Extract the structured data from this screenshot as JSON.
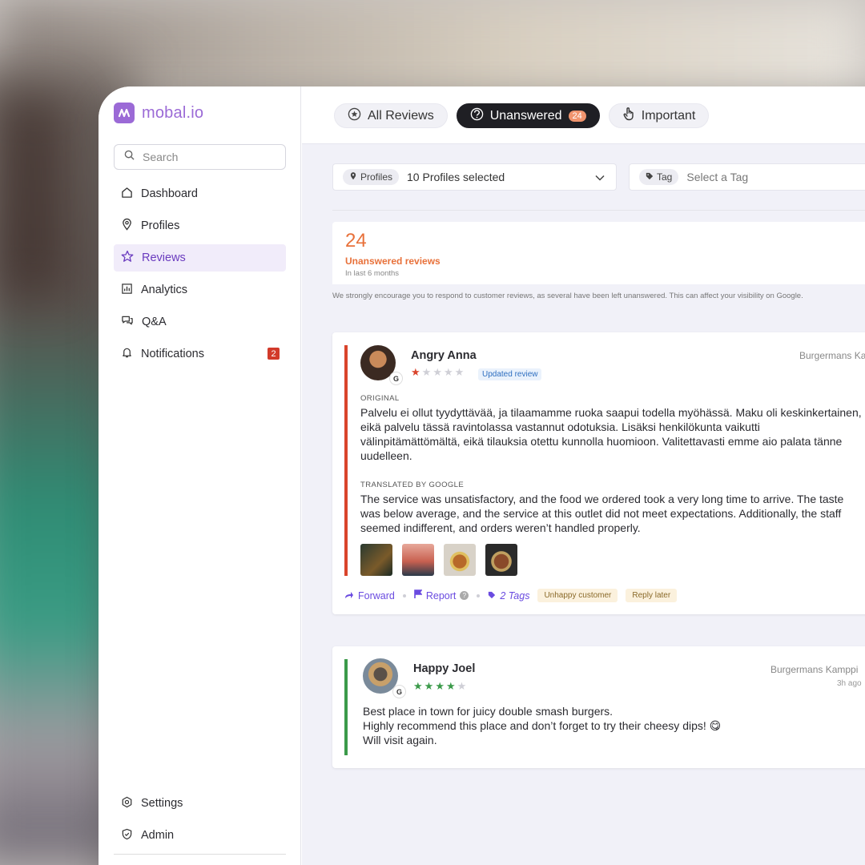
{
  "brand": {
    "name": "mobal.io",
    "color": "#9b6ad6"
  },
  "search": {
    "placeholder": "Search"
  },
  "sidebar": {
    "items": [
      {
        "label": "Dashboard",
        "icon": "home-icon"
      },
      {
        "label": "Profiles",
        "icon": "pin-icon"
      },
      {
        "label": "Reviews",
        "icon": "star-icon",
        "active": true
      },
      {
        "label": "Analytics",
        "icon": "chart-icon"
      },
      {
        "label": "Q&A",
        "icon": "chat-icon"
      },
      {
        "label": "Notifications",
        "icon": "bell-icon",
        "badge": "2"
      }
    ],
    "bottom": [
      {
        "label": "Settings",
        "icon": "gear-icon"
      },
      {
        "label": "Admin",
        "icon": "shield-icon"
      }
    ]
  },
  "tabs": [
    {
      "label": "All Reviews",
      "icon": "star-circle-icon"
    },
    {
      "label": "Unanswered",
      "icon": "chat-bubble-icon",
      "count": "24",
      "active": true
    },
    {
      "label": "Important",
      "icon": "hand-icon"
    }
  ],
  "filters": {
    "profiles": {
      "chip": "Profiles",
      "value": "10 Profiles selected"
    },
    "tag": {
      "chip": "Tag",
      "placeholder": "Select a Tag"
    }
  },
  "stats": {
    "count": "24",
    "label": "Unanswered reviews",
    "sub": "In last 6 months",
    "note": "We strongly encourage you to respond to customer reviews, as several have been left unanswered. This can affect your visibility on Google."
  },
  "reviews": [
    {
      "name": "Angry Anna",
      "rating": 1,
      "badge": "Updated review",
      "location": "Burgermans Kampi",
      "original_label": "ORIGINAL",
      "original": "Palvelu ei ollut tyydyttävää, ja tilaamamme ruoka saapui todella myöhässä. Maku oli keskinkertainen,\neikä palvelu tässä ravintolassa vastannut odotuksia. Lisäksi henkilökunta vaikutti\nvälinpitämättömältä, eikä tilauksia otettu kunnolla huomioon. Valitettavasti emme aio palata tänne\nuudelleen.",
      "translated_label": "TRANSLATED BY GOOGLE",
      "translated": "The service was unsatisfactory, and the food we ordered took a very long time to arrive. The taste\nwas below average, and the service at this outlet did not meet expectations. Additionally, the staff\nseemed indifferent, and orders weren’t handled properly.",
      "actions": {
        "forward": "Forward",
        "report": "Report",
        "tags": "2 Tags"
      },
      "tags": [
        "Unhappy customer",
        "Reply later"
      ],
      "accent": "#d9442c"
    },
    {
      "name": "Happy Joel",
      "rating": 4,
      "location": "Burgermans Kamppi",
      "time": "3h ago",
      "text": "Best place in town for juicy double smash burgers.\nHighly recommend this place and don’t forget to try their cheesy dips! 😋\nWill visit again.",
      "accent": "#3b9a4a"
    }
  ]
}
